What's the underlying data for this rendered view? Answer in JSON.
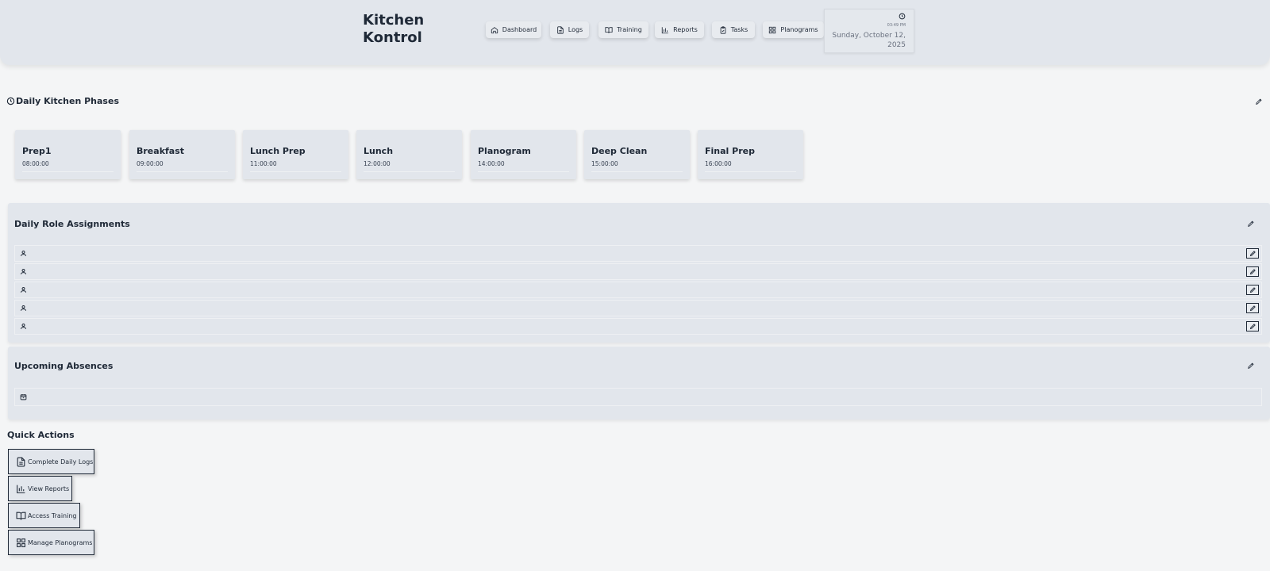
{
  "app": {
    "title_line1": "Kitchen",
    "title_line2": "Kontrol"
  },
  "nav": [
    {
      "label": "Dashboard",
      "icon": "home-icon"
    },
    {
      "label": "Logs",
      "icon": "file-text-icon"
    },
    {
      "label": "Training",
      "icon": "book-open-icon"
    },
    {
      "label": "Reports",
      "icon": "bar-chart-icon"
    },
    {
      "label": "Tasks",
      "icon": "clipboard-check-icon"
    },
    {
      "label": "Planograms",
      "icon": "grid-icon"
    }
  ],
  "clock": {
    "time": "03:49 PM",
    "date": "Sunday, October 12, 2025",
    "icon": "clock-icon"
  },
  "phases": {
    "title": "Daily Kitchen Phases",
    "icon": "clock-icon",
    "items": [
      {
        "name": "Prep1",
        "time": "08:00:00"
      },
      {
        "name": "Breakfast",
        "time": "09:00:00"
      },
      {
        "name": "Lunch Prep",
        "time": "11:00:00"
      },
      {
        "name": "Lunch",
        "time": "12:00:00"
      },
      {
        "name": "Planogram",
        "time": "14:00:00"
      },
      {
        "name": "Deep Clean",
        "time": "15:00:00"
      },
      {
        "name": "Final Prep",
        "time": "16:00:00"
      }
    ]
  },
  "roles": {
    "title": "Daily Role Assignments",
    "row_count": 5,
    "row_icon": "user-icon"
  },
  "absences": {
    "title": "Upcoming Absences",
    "row_icon": "calendar-icon"
  },
  "quick_actions": {
    "title": "Quick Actions",
    "items": [
      {
        "label": "Complete Daily Logs",
        "icon": "file-text-icon"
      },
      {
        "label": "View Reports",
        "icon": "bar-chart-icon"
      },
      {
        "label": "Access Training",
        "icon": "book-open-icon"
      },
      {
        "label": "Manage Planograms",
        "icon": "grid-icon"
      }
    ]
  },
  "colors": {
    "header_bg": "#e2e6ec",
    "page_bg": "#f4f5f6",
    "text": "#1f2937"
  }
}
